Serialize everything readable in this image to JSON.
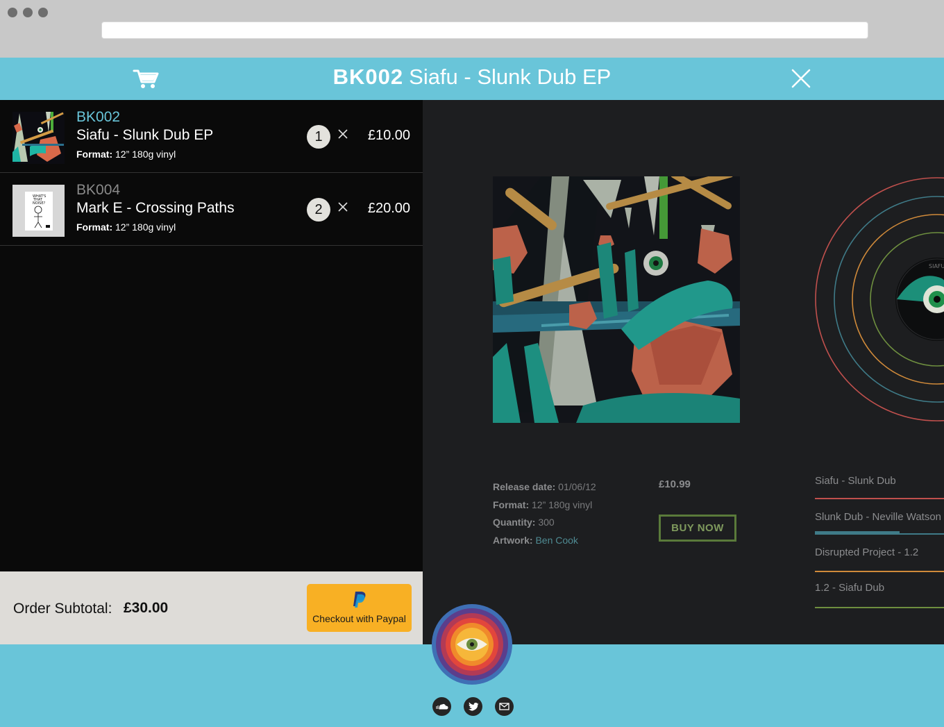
{
  "header": {
    "code": "BK002",
    "title": "Siafu - Slunk Dub EP"
  },
  "cart": {
    "items": [
      {
        "code": "BK002",
        "title": "Siafu - Slunk Dub EP",
        "format_label": "Format:",
        "format_value": "12” 180g vinyl",
        "quantity": "1",
        "price": "£10.00",
        "code_color": "#69c5d9"
      },
      {
        "code": "BK004",
        "title": "Mark E - Crossing Paths",
        "format_label": "Format:",
        "format_value": "12” 180g vinyl",
        "quantity": "2",
        "price": "£20.00",
        "code_color": "#8a8a8a",
        "cover_text": "WHAT'S THAT NOISE?"
      }
    ],
    "subtotal_label": "Order Subtotal:",
    "subtotal_value": "£30.00",
    "checkout_label": "Checkout with Paypal"
  },
  "release": {
    "release_date_label": "Release date:",
    "release_date": "01/06/12",
    "format_label": "Format:",
    "format": "12” 180g vinyl",
    "quantity_label": "Quantity:",
    "quantity": "300",
    "artwork_label": "Artwork:",
    "artwork": "Ben Cook",
    "price": "£10.99",
    "buy_label": "BUY NOW",
    "label_text": "SIAFU"
  },
  "tracklist": [
    {
      "name": "Siafu - Slunk Dub",
      "color": "#c0504d"
    },
    {
      "name": "Slunk Dub - Neville Watson",
      "color": "#3f7b88"
    },
    {
      "name": "Disrupted Project - 1.2",
      "color": "#d08a3a"
    },
    {
      "name": "1.2 - Siafu Dub",
      "color": "#6e8f3f"
    }
  ],
  "icons": {
    "cart": "cart-icon",
    "close": "close-icon",
    "remove": "x-icon",
    "paypal": "paypal-icon",
    "logo": "eye-logo-icon",
    "soundcloud": "soundcloud-icon",
    "twitter": "twitter-icon",
    "email": "mail-icon"
  },
  "colors": {
    "accent": "#69c5d9",
    "paypal": "#f8b024",
    "panel_dark": "#0a0a0a",
    "main_dark": "#1d1e20"
  }
}
